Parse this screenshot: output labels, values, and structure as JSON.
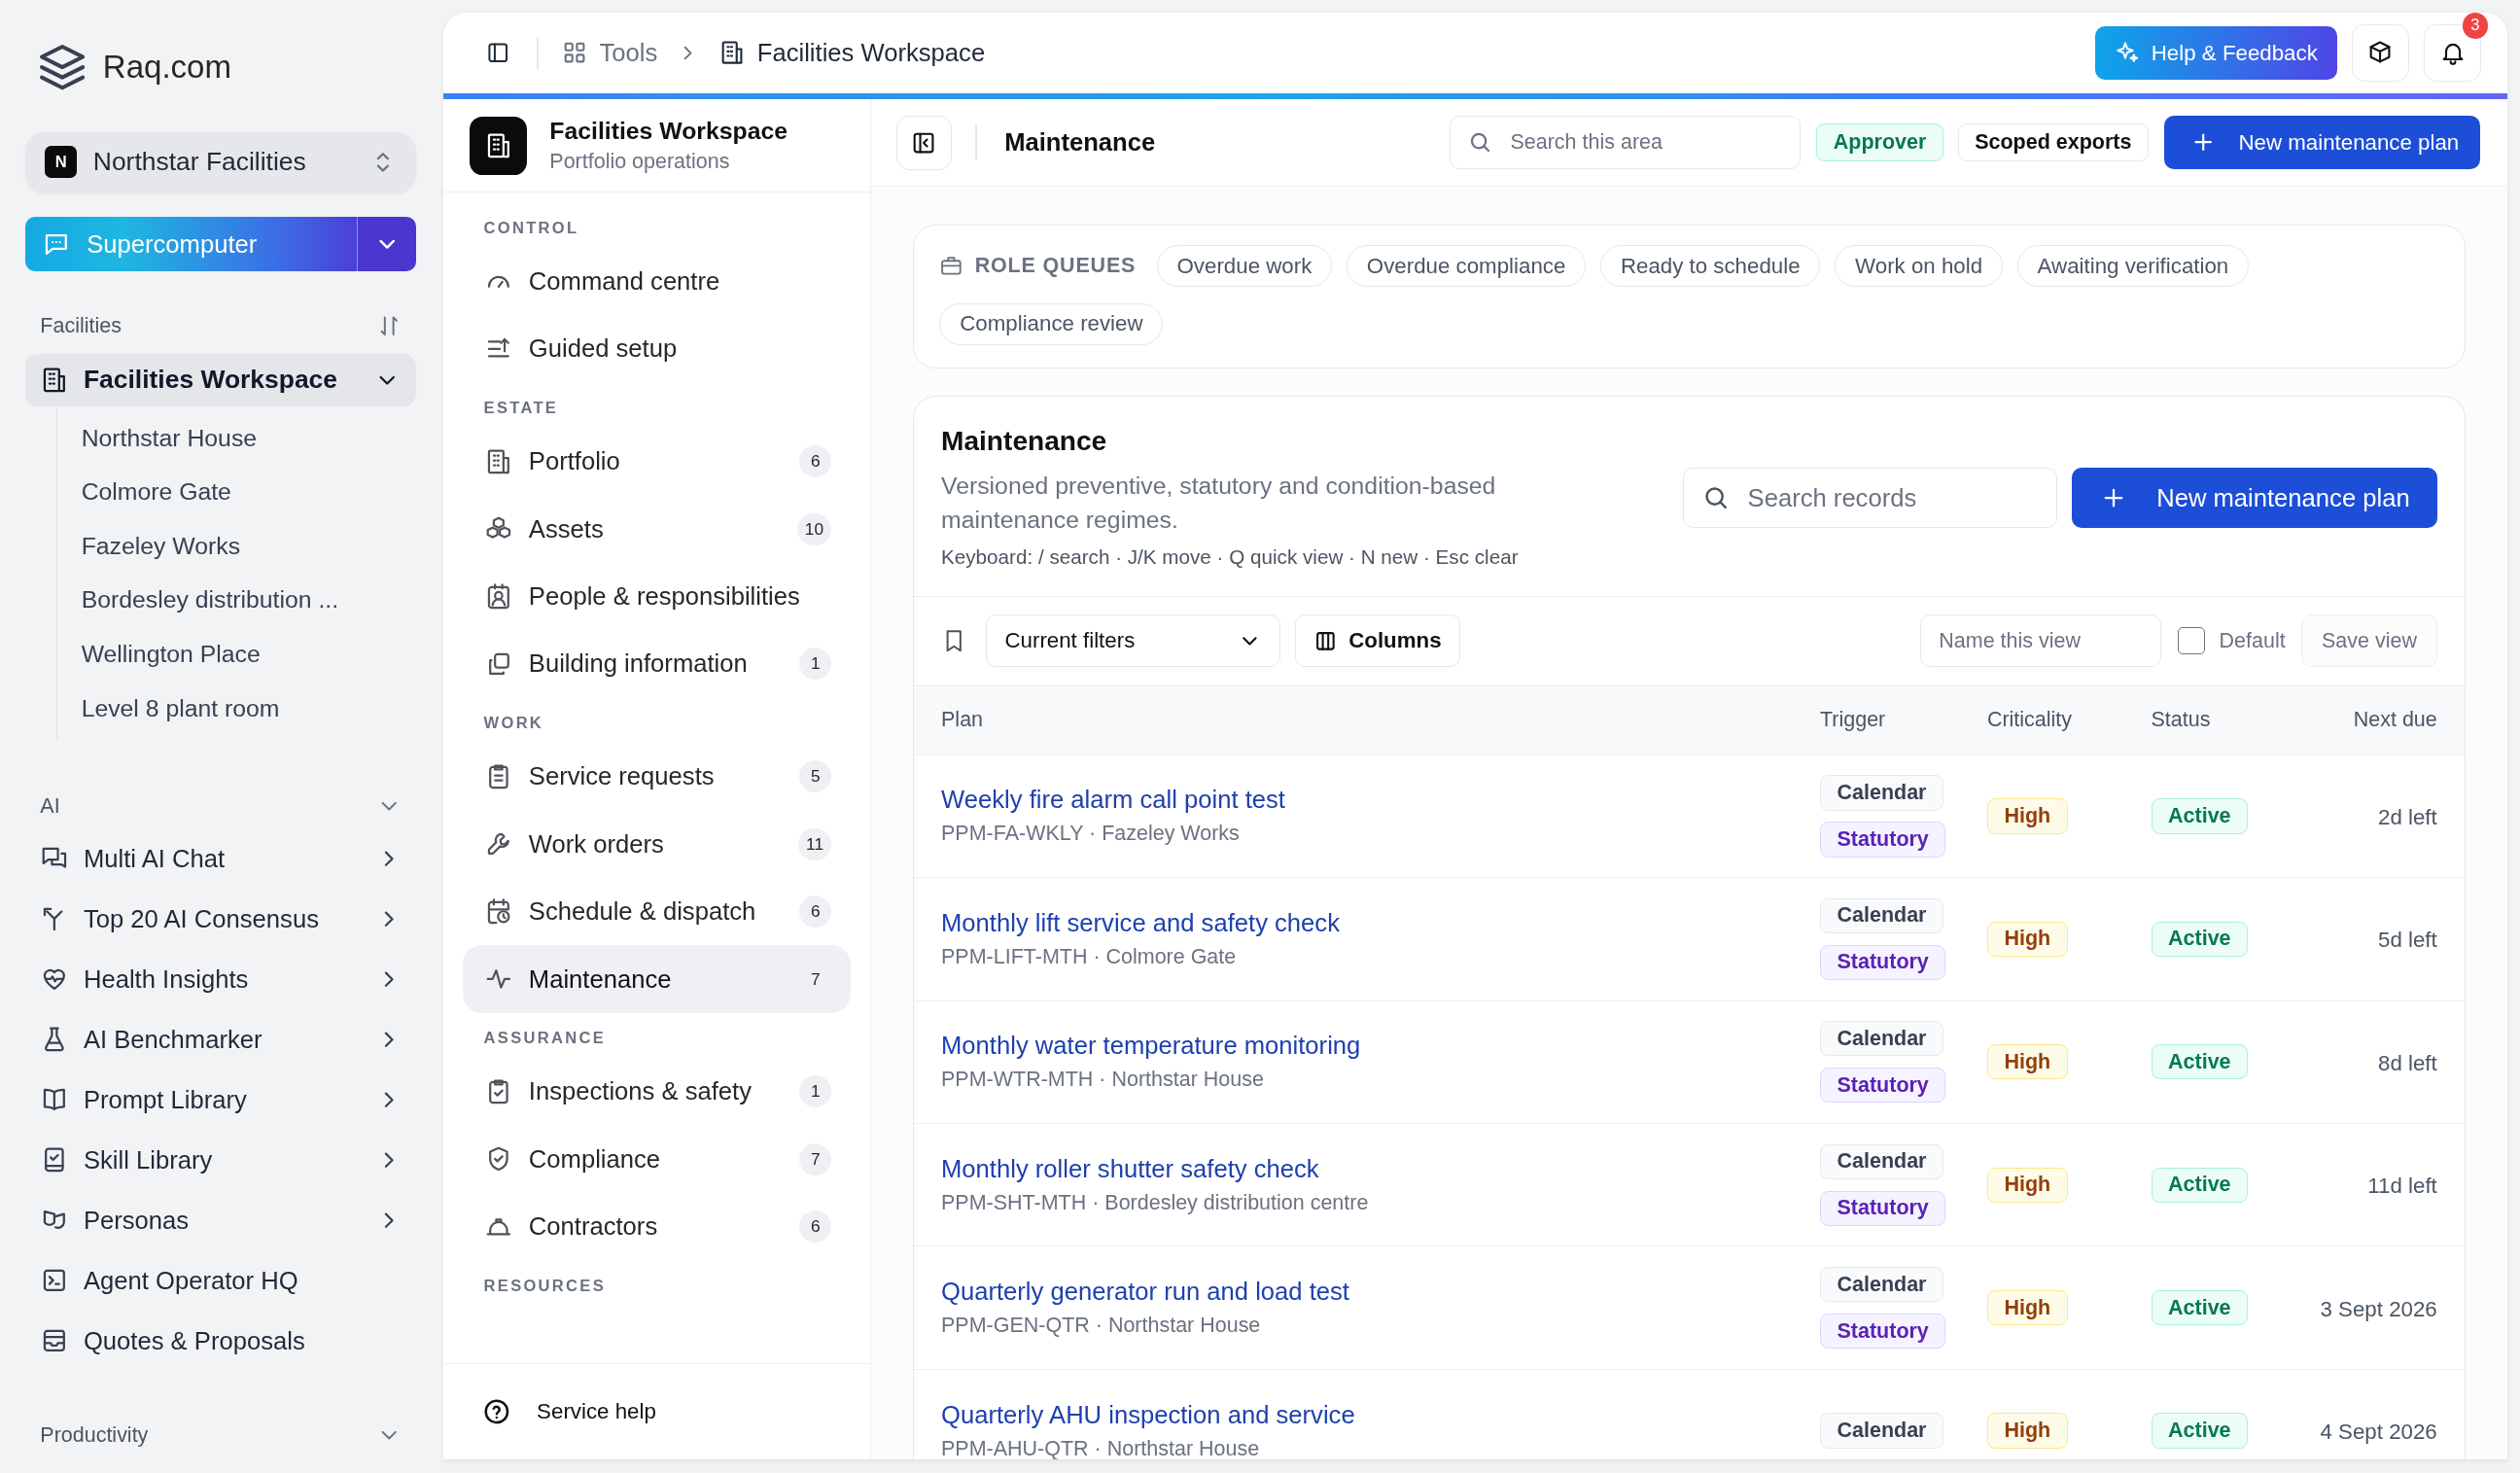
{
  "brand": {
    "name": "Raq.com"
  },
  "org_switcher": {
    "initial": "N",
    "name": "Northstar Facilities"
  },
  "supercomputer": {
    "label": "Supercomputer"
  },
  "sidebar": {
    "facilities": {
      "title": "Facilities",
      "workspace": {
        "label": "Facilities Workspace",
        "selected": true,
        "expanded": true,
        "children": [
          {
            "label": "Northstar House"
          },
          {
            "label": "Colmore Gate"
          },
          {
            "label": "Fazeley Works"
          },
          {
            "label": "Bordesley distribution ..."
          },
          {
            "label": "Wellington Place"
          },
          {
            "label": "Level 8 plant room"
          }
        ]
      }
    },
    "ai": {
      "title": "AI",
      "items": [
        {
          "label": "Multi AI Chat",
          "has_submenu": true
        },
        {
          "label": "Top 20 AI Consensus",
          "has_submenu": true
        },
        {
          "label": "Health Insights",
          "has_submenu": true
        },
        {
          "label": "AI Benchmarker",
          "has_submenu": true
        },
        {
          "label": "Prompt Library",
          "has_submenu": true
        },
        {
          "label": "Skill Library",
          "has_submenu": true
        },
        {
          "label": "Personas",
          "has_submenu": true
        },
        {
          "label": "Agent Operator HQ",
          "has_submenu": false
        },
        {
          "label": "Quotes & Proposals",
          "has_submenu": false
        }
      ]
    },
    "productivity": {
      "title": "Productivity"
    }
  },
  "topbar": {
    "breadcrumbs": [
      {
        "label": "Tools"
      },
      {
        "label": "Facilities Workspace"
      }
    ],
    "help_button": "Help & Feedback",
    "notification_count": "3"
  },
  "workspace_nav": {
    "title": "Facilities Workspace",
    "subtitle": "Portfolio operations",
    "sections": [
      {
        "title": "CONTROL",
        "items": [
          {
            "label": "Command centre",
            "selected": false
          },
          {
            "label": "Guided setup",
            "selected": false
          }
        ]
      },
      {
        "title": "ESTATE",
        "items": [
          {
            "label": "Portfolio",
            "count": "6",
            "selected": false
          },
          {
            "label": "Assets",
            "count": "10",
            "selected": false
          },
          {
            "label": "People & responsibilities",
            "selected": false
          },
          {
            "label": "Building information",
            "count": "1",
            "selected": false
          }
        ]
      },
      {
        "title": "WORK",
        "items": [
          {
            "label": "Service requests",
            "count": "5",
            "selected": false
          },
          {
            "label": "Work orders",
            "count": "11",
            "selected": false
          },
          {
            "label": "Schedule & dispatch",
            "count": "6",
            "selected": false
          },
          {
            "label": "Maintenance",
            "count": "7",
            "selected": true
          }
        ]
      },
      {
        "title": "ASSURANCE",
        "items": [
          {
            "label": "Inspections & safety",
            "count": "1",
            "selected": false
          },
          {
            "label": "Compliance",
            "count": "7",
            "selected": false
          },
          {
            "label": "Contractors",
            "count": "6",
            "selected": false
          }
        ]
      },
      {
        "title": "RESOURCES"
      }
    ],
    "footer": {
      "label": "Service help"
    }
  },
  "page_header": {
    "title": "Maintenance",
    "search": {
      "placeholder": "Search this area"
    },
    "badges": [
      {
        "label": "Approver",
        "kind": "role"
      },
      {
        "label": "Scoped exports",
        "kind": "scope"
      }
    ],
    "primary_button": "New maintenance plan"
  },
  "role_queues": {
    "title": "ROLE QUEUES",
    "chips": [
      "Overdue work",
      "Overdue compliance",
      "Ready to schedule",
      "Work on hold",
      "Awaiting verification",
      "Compliance review"
    ]
  },
  "maintenance": {
    "title": "Maintenance",
    "description": "Versioned preventive, statutory and condition-based maintenance regimes.",
    "shortcuts": "Keyboard: / search · J/K move · Q quick view · N new · Esc clear",
    "search": {
      "placeholder": "Search records"
    },
    "primary_button": "New maintenance plan",
    "toolbar": {
      "filter": {
        "value": "Current filters"
      },
      "columns_button": "Columns",
      "view_name": {
        "placeholder": "Name this view"
      },
      "default_checkbox": {
        "label": "Default",
        "checked": false
      },
      "save_button": {
        "label": "Save view",
        "disabled": true
      }
    },
    "table": {
      "columns": [
        "Plan",
        "Trigger",
        "Criticality",
        "Status",
        "Next due"
      ],
      "rows": [
        {
          "plan": "Weekly fire alarm call point test",
          "meta": "PPM-FA-WKLY · Fazeley Works",
          "triggers": [
            {
              "label": "Calendar",
              "kind": "calendar"
            },
            {
              "label": "Statutory",
              "kind": "statutory"
            }
          ],
          "criticality": {
            "label": "High",
            "kind": "high"
          },
          "status": {
            "label": "Active",
            "kind": "active"
          },
          "next_due": "2d left"
        },
        {
          "plan": "Monthly lift service and safety check",
          "meta": "PPM-LIFT-MTH · Colmore Gate",
          "triggers": [
            {
              "label": "Calendar",
              "kind": "calendar"
            },
            {
              "label": "Statutory",
              "kind": "statutory"
            }
          ],
          "criticality": {
            "label": "High",
            "kind": "high"
          },
          "status": {
            "label": "Active",
            "kind": "active"
          },
          "next_due": "5d left"
        },
        {
          "plan": "Monthly water temperature monitoring",
          "meta": "PPM-WTR-MTH · Northstar House",
          "triggers": [
            {
              "label": "Calendar",
              "kind": "calendar"
            },
            {
              "label": "Statutory",
              "kind": "statutory"
            }
          ],
          "criticality": {
            "label": "High",
            "kind": "high"
          },
          "status": {
            "label": "Active",
            "kind": "active"
          },
          "next_due": "8d left"
        },
        {
          "plan": "Monthly roller shutter safety check",
          "meta": "PPM-SHT-MTH · Bordesley distribution centre",
          "triggers": [
            {
              "label": "Calendar",
              "kind": "calendar"
            },
            {
              "label": "Statutory",
              "kind": "statutory"
            }
          ],
          "criticality": {
            "label": "High",
            "kind": "high"
          },
          "status": {
            "label": "Active",
            "kind": "active"
          },
          "next_due": "11d left"
        },
        {
          "plan": "Quarterly generator run and load test",
          "meta": "PPM-GEN-QTR · Northstar House",
          "triggers": [
            {
              "label": "Calendar",
              "kind": "calendar"
            },
            {
              "label": "Statutory",
              "kind": "statutory"
            }
          ],
          "criticality": {
            "label": "High",
            "kind": "high"
          },
          "status": {
            "label": "Active",
            "kind": "active"
          },
          "next_due": "3 Sept 2026"
        },
        {
          "plan": "Quarterly AHU inspection and service",
          "meta": "PPM-AHU-QTR · Northstar House",
          "triggers": [
            {
              "label": "Calendar",
              "kind": "calendar"
            }
          ],
          "criticality": {
            "label": "High",
            "kind": "high"
          },
          "status": {
            "label": "Active",
            "kind": "active"
          },
          "next_due": "4 Sept 2026"
        }
      ]
    }
  }
}
